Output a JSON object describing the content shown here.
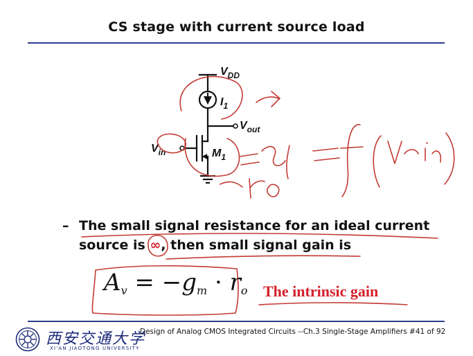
{
  "slide": {
    "title": "CS stage with current source load"
  },
  "circuit": {
    "vdd_label": "V",
    "vdd_sub": "DD",
    "i1_label": "I",
    "i1_sub": "1",
    "vout_label": "V",
    "vout_sub": "out",
    "vin_label": "V",
    "vin_sub": "in",
    "m1_label": "M",
    "m1_sub": "1"
  },
  "bullet": {
    "dash": "–",
    "line1": "The small signal resistance for an ideal  current",
    "line2_pre": "source is ",
    "line2_symbol": "∞",
    "line2_post": ", then small signal gain is"
  },
  "formula": {
    "lhs": "A",
    "lhs_sub": "v",
    "eq": " = −",
    "gm": "g",
    "gm_sub": "m",
    "dot": " · ",
    "ro": "r",
    "ro_sub": "o"
  },
  "annotation": {
    "intrinsic_gain": "The intrinsic gain"
  },
  "footer": {
    "university_cn": "西安交通大学",
    "university_en": "XI'AN JIAOTONG UNIVERSITY",
    "course_text": "Design of Analog CMOS Integrated Circuits   --Ch.3 Single-Stage Amplifiers  #41 of 92"
  },
  "colors": {
    "accent_rule": "#2d3a8c",
    "highlight_red": "#d4202c",
    "pen_red": "#c23a33",
    "logo_blue": "#1b2a7a"
  }
}
